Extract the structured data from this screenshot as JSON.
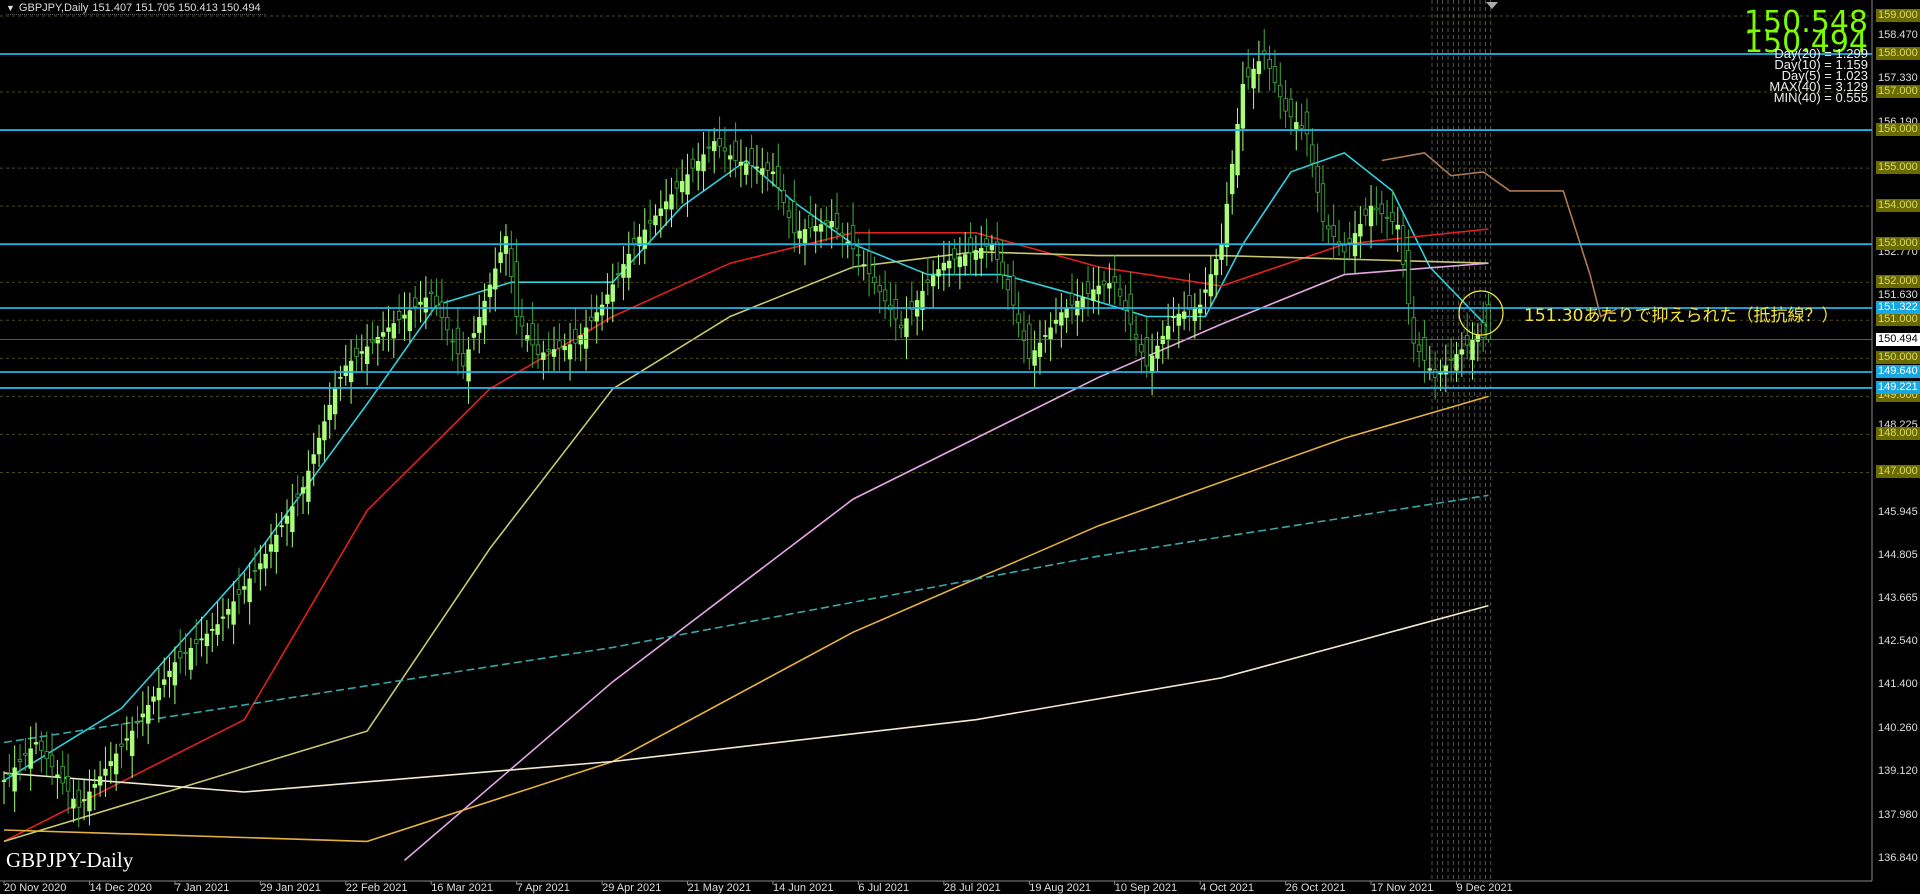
{
  "header": {
    "symbol": "GBPJPY,Daily",
    "ohlc": "151.407 151.705 150.413 150.494"
  },
  "bid_ask": {
    "ask": "150.548",
    "bid": "150.494"
  },
  "stats": [
    "Day(20) = 1.299",
    "Day(10) = 1.159",
    "Day(5) = 1.023",
    "MAX(40) = 3.129",
    "MIN(40) = 0.555"
  ],
  "watermark": "GBPJPY-Daily",
  "annotation": "151.30あたりで抑えられた（抵抗線？）",
  "colors": {
    "up": "#a8ff7a",
    "down": "#3fae3f",
    "hline": "#1fb4e6",
    "annotation": "#f4e53a"
  },
  "chart_data": {
    "type": "candlestick",
    "title": "GBPJPY Daily",
    "ylim": [
      136.4,
      159.3
    ],
    "x_tick_labels": [
      "20 Nov 2020",
      "14 Dec 2020",
      "7 Jan 2021",
      "29 Jan 2021",
      "22 Feb 2021",
      "16 Mar 2021",
      "7 Apr 2021",
      "29 Apr 2021",
      "21 May 2021",
      "14 Jun 2021",
      "6 Jul 2021",
      "28 Jul 2021",
      "19 Aug 2021",
      "10 Sep 2021",
      "4 Oct 2021",
      "26 Oct 2021",
      "17 Nov 2021",
      "9 Dec 2021"
    ],
    "x_tick_bar_step": 16,
    "price_ticks": [
      "158.470",
      "157.330",
      "156.190",
      "152.770",
      "151.630",
      "148.225",
      "145.945",
      "144.805",
      "143.665",
      "142.540",
      "141.400",
      "140.260",
      "139.120",
      "137.980",
      "136.840"
    ],
    "level_labels": [
      "159.000",
      "158.000",
      "157.000",
      "156.000",
      "155.000",
      "154.000",
      "153.000",
      "152.000",
      "151.000",
      "150.000",
      "149.000",
      "148.000",
      "147.000"
    ],
    "horizontal_lines": [
      "158.000",
      "156.000",
      "153.000",
      "151.322",
      "149.640",
      "149.221"
    ],
    "current_price": "150.494",
    "close_anchors": [
      [
        0,
        138.9
      ],
      [
        6,
        139.9
      ],
      [
        14,
        138.2
      ],
      [
        16,
        138.6
      ],
      [
        24,
        140.2
      ],
      [
        32,
        142
      ],
      [
        40,
        143
      ],
      [
        48,
        144.6
      ],
      [
        56,
        146.6
      ],
      [
        62,
        149.2
      ],
      [
        64,
        149.8
      ],
      [
        72,
        150.8
      ],
      [
        80,
        151.7
      ],
      [
        86,
        149.8
      ],
      [
        94,
        153.2
      ],
      [
        96,
        151.1
      ],
      [
        100,
        150.1
      ],
      [
        107,
        150.4
      ],
      [
        112,
        151.4
      ],
      [
        118,
        153
      ],
      [
        125,
        154.3
      ],
      [
        133,
        155.7
      ],
      [
        137,
        155.2
      ],
      [
        144,
        154.9
      ],
      [
        148,
        153.3
      ],
      [
        155,
        153.6
      ],
      [
        160,
        152.7
      ],
      [
        168,
        150.8
      ],
      [
        173,
        152
      ],
      [
        176,
        152.5
      ],
      [
        185,
        153
      ],
      [
        189,
        151.4
      ],
      [
        192,
        150
      ],
      [
        198,
        151.2
      ],
      [
        205,
        151.9
      ],
      [
        208,
        152
      ],
      [
        214,
        149.8
      ],
      [
        219,
        151.1
      ],
      [
        224,
        151.4
      ],
      [
        228,
        153
      ],
      [
        232,
        157.2
      ],
      [
        236,
        158
      ],
      [
        240,
        156.5
      ],
      [
        244,
        155.9
      ],
      [
        247,
        153.6
      ],
      [
        251,
        152.8
      ],
      [
        256,
        154
      ],
      [
        261,
        153.5
      ],
      [
        264,
        150.4
      ],
      [
        268,
        149.5
      ],
      [
        272,
        150.1
      ],
      [
        276,
        150.6
      ],
      [
        278,
        150.494
      ]
    ],
    "last_candle": {
      "open": 151.407,
      "high": 151.705,
      "low": 150.413,
      "close": 150.494
    },
    "series": [
      {
        "name": "ma-cyan",
        "color": "#2fd0e0",
        "dash": "",
        "points": [
          [
            0,
            138.9
          ],
          [
            22,
            140.8
          ],
          [
            45,
            144.4
          ],
          [
            68,
            148.8
          ],
          [
            81,
            151.4
          ],
          [
            95,
            152
          ],
          [
            114,
            152
          ],
          [
            127,
            154
          ],
          [
            139,
            155.2
          ],
          [
            148,
            154.1
          ],
          [
            159,
            153
          ],
          [
            173,
            152.2
          ],
          [
            187,
            152.2
          ],
          [
            200,
            151.7
          ],
          [
            214,
            151.1
          ],
          [
            225,
            151.1
          ],
          [
            232,
            153
          ],
          [
            241,
            154.9
          ],
          [
            251,
            155.4
          ],
          [
            260,
            154.4
          ],
          [
            267,
            152.4
          ],
          [
            278,
            150.8
          ]
        ]
      },
      {
        "name": "ma-red",
        "color": "#e02020",
        "dash": "",
        "points": [
          [
            0,
            137.3
          ],
          [
            45,
            140.5
          ],
          [
            68,
            146
          ],
          [
            91,
            149.2
          ],
          [
            114,
            151.1
          ],
          [
            136,
            152.5
          ],
          [
            159,
            153.3
          ],
          [
            182,
            153.3
          ],
          [
            205,
            152.4
          ],
          [
            228,
            151.9
          ],
          [
            251,
            153
          ],
          [
            278,
            153.4
          ]
        ]
      },
      {
        "name": "ma-khaki",
        "color": "#c8c870",
        "dash": "",
        "points": [
          [
            0,
            137.3
          ],
          [
            68,
            140.2
          ],
          [
            91,
            145
          ],
          [
            114,
            149.2
          ],
          [
            136,
            151.1
          ],
          [
            159,
            152.4
          ],
          [
            182,
            152.8
          ],
          [
            205,
            152.7
          ],
          [
            228,
            152.7
          ],
          [
            278,
            152.5
          ]
        ]
      },
      {
        "name": "ma-pink",
        "color": "#e6a6e6",
        "dash": "",
        "points": [
          [
            75,
            136.8
          ],
          [
            114,
            141.5
          ],
          [
            159,
            146.3
          ],
          [
            205,
            149.5
          ],
          [
            228,
            150.9
          ],
          [
            251,
            152.2
          ],
          [
            278,
            152.5
          ]
        ]
      },
      {
        "name": "ma-orange",
        "color": "#e6b040",
        "dash": "",
        "points": [
          [
            0,
            137.6
          ],
          [
            68,
            137.3
          ],
          [
            114,
            139.4
          ],
          [
            159,
            142.8
          ],
          [
            205,
            145.6
          ],
          [
            251,
            147.9
          ],
          [
            278,
            149
          ]
        ]
      },
      {
        "name": "ma-cream",
        "color": "#f2ead0",
        "dash": "",
        "points": [
          [
            0,
            139.1
          ],
          [
            45,
            138.6
          ],
          [
            114,
            139.4
          ],
          [
            182,
            140.5
          ],
          [
            228,
            141.6
          ],
          [
            278,
            143.5
          ]
        ]
      },
      {
        "name": "ma-teal-dashed",
        "color": "#3aa6a6",
        "dash": "8,4",
        "points": [
          [
            0,
            139.9
          ],
          [
            114,
            142.4
          ],
          [
            205,
            144.8
          ],
          [
            278,
            146.4
          ]
        ]
      },
      {
        "name": "ichimoku-span",
        "color": "#b07a50",
        "dash": "",
        "points": [
          [
            258,
            155.2
          ],
          [
            266,
            155.4
          ],
          [
            271,
            154.8
          ],
          [
            277,
            154.9
          ],
          [
            282,
            154.4
          ],
          [
            292,
            154.4
          ],
          [
            297,
            152.2
          ],
          [
            299,
            151.1
          ],
          [
            302,
            151.3
          ]
        ]
      }
    ]
  }
}
